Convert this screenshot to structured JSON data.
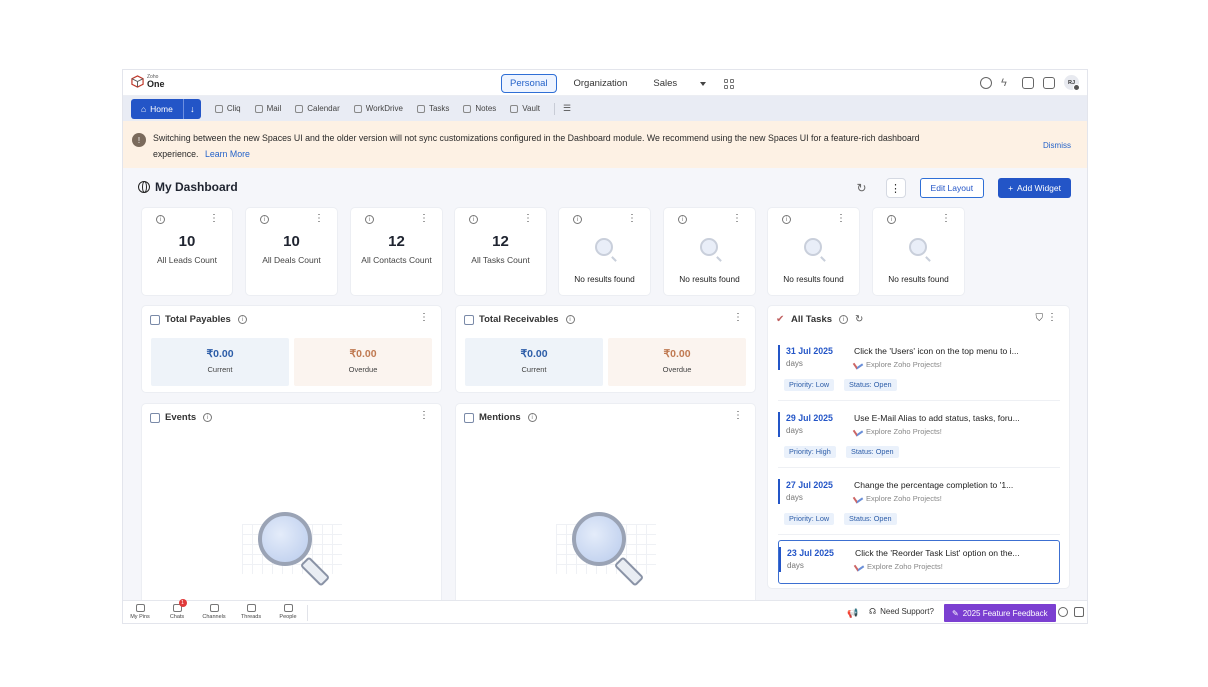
{
  "topbar": {
    "logo_small": "Zoho",
    "logo_big": "One",
    "spaces": [
      "Personal",
      "Organization",
      "Sales"
    ],
    "avatar": "RJ"
  },
  "nav": {
    "home": "Home",
    "items": [
      "Cliq",
      "Mail",
      "Calendar",
      "WorkDrive",
      "Tasks",
      "Notes",
      "Vault"
    ]
  },
  "banner": {
    "text": "Switching between the new Spaces UI and the older version will not sync customizations configured in the Dashboard module. We recommend using the new Spaces UI for a feature-rich dashboard experience.",
    "link": "Learn More",
    "dismiss": "Dismiss"
  },
  "dashboard": {
    "title": "My Dashboard",
    "edit_layout": "Edit Layout",
    "add_widget": "Add Widget"
  },
  "stats": [
    {
      "value": "10",
      "label": "All Leads Count"
    },
    {
      "value": "10",
      "label": "All Deals Count"
    },
    {
      "value": "12",
      "label": "All Contacts Count"
    },
    {
      "value": "12",
      "label": "All Tasks Count"
    }
  ],
  "empty_text": "No results found",
  "payables": {
    "title": "Total Payables",
    "current_value": "₹0.00",
    "current_label": "Current",
    "overdue_value": "₹0.00",
    "overdue_label": "Overdue"
  },
  "receivables": {
    "title": "Total Receivables",
    "current_value": "₹0.00",
    "current_label": "Current",
    "overdue_value": "₹0.00",
    "overdue_label": "Overdue"
  },
  "events": {
    "title": "Events"
  },
  "mentions": {
    "title": "Mentions"
  },
  "tasks": {
    "title": "All Tasks",
    "items": [
      {
        "date": "31 Jul 2025",
        "days": "days",
        "title": "Click the 'Users' icon on the top menu to i...",
        "project": "Explore Zoho Projects!",
        "priority": "Priority: Low",
        "status": "Status: Open"
      },
      {
        "date": "29 Jul 2025",
        "days": "days",
        "title": "Use E-Mail Alias to add status, tasks, foru...",
        "project": "Explore Zoho Projects!",
        "priority": "Priority: High",
        "status": "Status: Open"
      },
      {
        "date": "27 Jul 2025",
        "days": "days",
        "title": "Change the percentage completion to '1...",
        "project": "Explore Zoho Projects!",
        "priority": "Priority: Low",
        "status": "Status: Open"
      },
      {
        "date": "23 Jul 2025",
        "days": "days",
        "title": "Click the 'Reorder Task List' option on the...",
        "project": "Explore Zoho Projects!"
      }
    ]
  },
  "bottombar": {
    "items": [
      "My Pins",
      "Chats",
      "Channels",
      "Threads",
      "People"
    ],
    "chats_badge": "1",
    "support": "Need Support?",
    "feedback": "2025 Feature Feedback"
  },
  "colors": {
    "primary": "#2355c7",
    "banner_bg": "#fdf1e4",
    "feedback_bg": "#7b3fd1",
    "overdue": "#c07a52"
  }
}
